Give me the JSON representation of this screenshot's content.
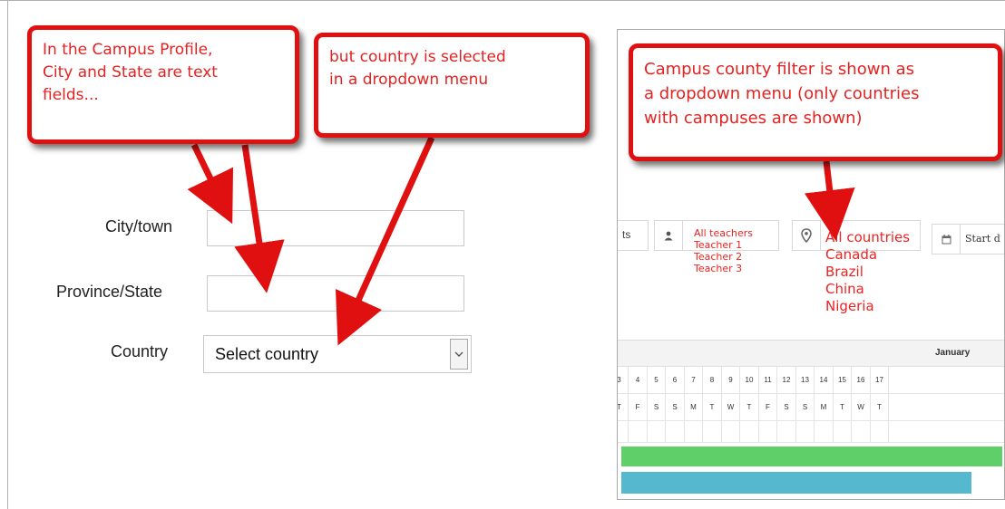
{
  "callouts": {
    "profile_text": "In the Campus Profile,\nCity and State are text\nfields...",
    "country_text": "but country is selected\nin a dropdown menu",
    "filter_text": "Campus county filter is shown as\na dropdown menu (only countries\nwith campuses are shown)"
  },
  "form": {
    "city_label": "City/town",
    "city_value": "",
    "province_label": "Province/State",
    "province_value": "",
    "country_label": "Country",
    "country_selected": "Select country"
  },
  "filters": {
    "partial_label": "ts",
    "teachers": [
      "All teachers",
      "Teacher 1",
      "Teacher 2",
      "Teacher 3"
    ],
    "countries": [
      "All countries",
      "Canada",
      "Brazil",
      "China",
      "Nigeria"
    ],
    "start_label": "Start d"
  },
  "calendar": {
    "month": "January",
    "dates": [
      "3",
      "4",
      "5",
      "6",
      "7",
      "8",
      "9",
      "10",
      "11",
      "12",
      "13",
      "14",
      "15",
      "16",
      "17"
    ],
    "weekdays": [
      "T",
      "F",
      "S",
      "S",
      "M",
      "T",
      "W",
      "T",
      "F",
      "S",
      "S",
      "M",
      "T",
      "W",
      "T"
    ]
  },
  "icons": {
    "teacher": "user-icon",
    "country": "map-marker-icon",
    "start": "calendar-icon",
    "select": "chevron-down-icon"
  },
  "colors": {
    "annotation_red": "#e01010",
    "text_red": "#e32222",
    "bar_green": "#5fcf6a",
    "bar_blue": "#56b8cf"
  }
}
